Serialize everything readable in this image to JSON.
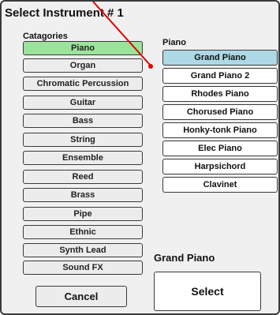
{
  "dialog": {
    "title": "Select Instrument # 1"
  },
  "categories": {
    "label": "Catagories",
    "items": [
      {
        "label": "Piano",
        "selected": true
      },
      {
        "label": "Organ"
      },
      {
        "label": "Chromatic Percussion"
      },
      {
        "label": "Guitar"
      },
      {
        "label": "Bass"
      },
      {
        "label": "String"
      },
      {
        "label": "Ensemble"
      },
      {
        "label": "Reed"
      },
      {
        "label": "Brass"
      },
      {
        "label": "Pipe"
      },
      {
        "label": "Ethnic"
      },
      {
        "label": "Synth Lead"
      },
      {
        "label": "Sound FX"
      }
    ]
  },
  "instruments": {
    "label": "Piano",
    "items": [
      {
        "label": "Grand Piano",
        "selected": true
      },
      {
        "label": "Grand Piano 2"
      },
      {
        "label": "Rhodes Piano"
      },
      {
        "label": "Chorused Piano"
      },
      {
        "label": "Honky-tonk Piano"
      },
      {
        "label": "Elec Piano"
      },
      {
        "label": "Harpsichord"
      },
      {
        "label": "Clavinet"
      }
    ]
  },
  "selection": {
    "name": "Grand Piano"
  },
  "buttons": {
    "cancel_label": "Cancel",
    "select_label": "Select"
  },
  "colors": {
    "category_selected": "#9be39b",
    "instrument_selected": "#add8e6",
    "pointer": "#e00000"
  },
  "icons": {
    "pointer": "red-pointer-arrow"
  }
}
